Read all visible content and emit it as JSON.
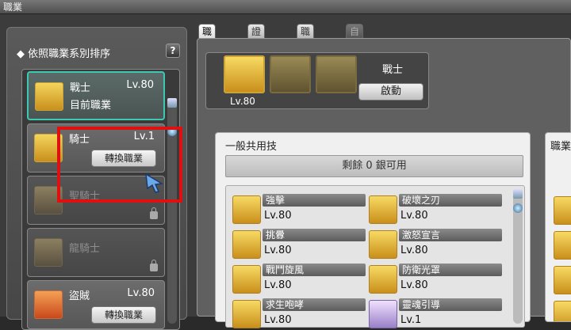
{
  "window": {
    "title": "職業"
  },
  "left_panel": {
    "sort_label": "依照職業系別排序",
    "help_label": "?",
    "jobs": [
      {
        "name": "戰士",
        "level": "Lv.80",
        "status": "目前職業",
        "icon": "warrior-icon",
        "state": "current"
      },
      {
        "name": "騎士",
        "level": "Lv.1",
        "button": "轉換職業",
        "icon": "knight-icon",
        "state": "available"
      },
      {
        "name": "聖騎士",
        "icon": "paladin-icon",
        "state": "locked"
      },
      {
        "name": "龍騎士",
        "icon": "dragon-knight-icon",
        "state": "locked"
      },
      {
        "name": "盜賊",
        "level": "Lv.80",
        "button": "轉換職業",
        "icon": "thief-icon",
        "state": "available"
      }
    ]
  },
  "tabs": [
    {
      "label": "職業技能",
      "state": "active"
    },
    {
      "label": "證照知識",
      "state": "normal"
    },
    {
      "label": "職業資訊",
      "state": "normal"
    },
    {
      "label": "自訂技能",
      "state": "disabled"
    }
  ],
  "job_bar": {
    "level": "Lv.80",
    "name": "戰士",
    "activate_label": "啟動"
  },
  "skills_section": {
    "title": "一般共用技",
    "remaining": "剩餘 0 銀可用",
    "skills": [
      {
        "name": "強擊",
        "level": "Lv.80",
        "icon": "strike-icon"
      },
      {
        "name": "破壞之刃",
        "level": "Lv.80",
        "icon": "destruction-blade-icon"
      },
      {
        "name": "挑釁",
        "level": "Lv.80",
        "icon": "provoke-icon"
      },
      {
        "name": "激怒宣言",
        "level": "Lv.80",
        "icon": "rage-declaration-icon"
      },
      {
        "name": "戰鬥旋風",
        "level": "Lv.80",
        "icon": "battle-whirlwind-icon"
      },
      {
        "name": "防衛光罩",
        "level": "Lv.80",
        "icon": "defense-shield-icon"
      },
      {
        "name": "求生咆哮",
        "level": "Lv.80",
        "icon": "survival-roar-icon"
      },
      {
        "name": "靈魂引導",
        "level": "Lv.1",
        "icon": "soul-guide-icon"
      }
    ]
  },
  "right_section": {
    "title": "職業"
  },
  "colors": {
    "current_border": "#3cc9b4",
    "highlight": "#e01010",
    "gold": "#f7da63"
  }
}
